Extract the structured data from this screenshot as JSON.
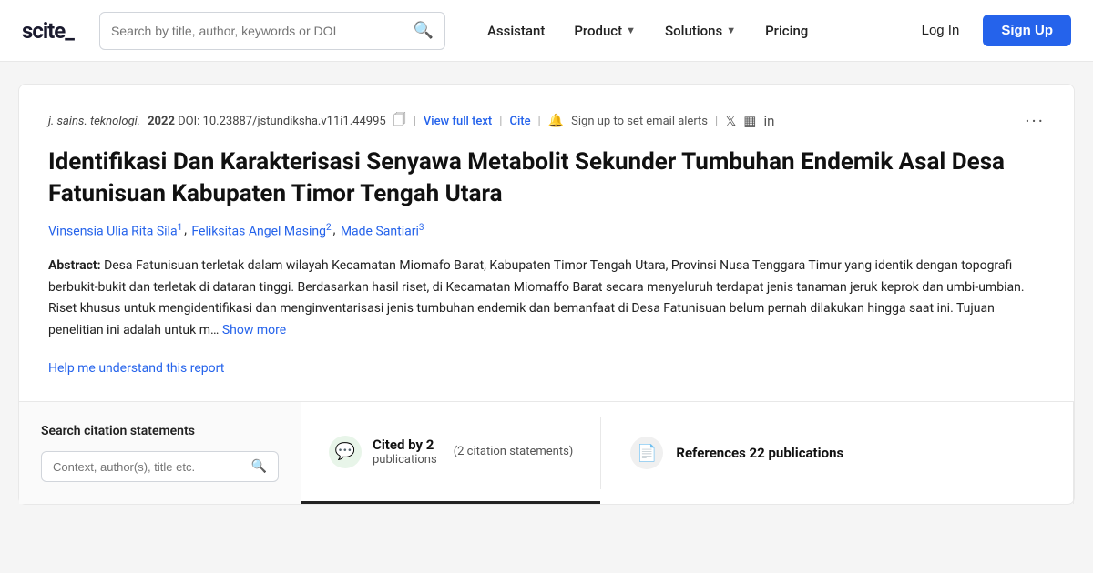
{
  "nav": {
    "logo": "scite_",
    "search_placeholder": "Search by title, author, keywords or DOI",
    "links": [
      {
        "label": "Assistant",
        "has_chevron": false
      },
      {
        "label": "Product",
        "has_chevron": true
      },
      {
        "label": "Solutions",
        "has_chevron": true
      },
      {
        "label": "Pricing",
        "has_chevron": false
      }
    ],
    "login_label": "Log In",
    "signup_label": "Sign Up"
  },
  "article": {
    "journal": "j. sains. teknologi.",
    "year": "2022",
    "doi_prefix": "DOI:",
    "doi": "10.23887/jstundiksha.v11i1.44995",
    "view_full_text": "View full text",
    "cite": "Cite",
    "sign_up_alerts": "Sign up to set email alerts",
    "title": "Identifikasi Dan Karakterisasi Senyawa Metabolit Sekunder Tumbuhan Endemik Asal Desa Fatunisuan Kabupaten Timor Tengah Utara",
    "authors": [
      {
        "name": "Vinsensia Ulia Rita Sila",
        "sup": "1"
      },
      {
        "name": "Feliksitas Angel Masing",
        "sup": "2"
      },
      {
        "name": "Made Santiari",
        "sup": "3"
      }
    ],
    "abstract_label": "Abstract:",
    "abstract_text": "Desa Fatunisuan terletak dalam wilayah Kecamatan Miomafo Barat, Kabupaten Timor Tengah Utara, Provinsi Nusa Tenggara Timur yang identik dengan topografi berbukit-bukit dan terletak di dataran tinggi. Berdasarkan hasil riset, di Kecamatan Miomaffo Barat secara menyeluruh terdapat jenis tanaman  jeruk keprok dan umbi-umbian. Riset khusus untuk mengidentifikasi dan menginventarisasi jenis tumbuhan endemik dan bemanfaat di Desa Fatunisuan belum pernah dilakukan hingga saat ini. Tujuan penelitian ini adalah untuk m…",
    "show_more": "Show more",
    "help_link": "Help me understand this report"
  },
  "citations": {
    "search_title": "Search citation statements",
    "search_placeholder": "Context, author(s), title etc.",
    "cited_by_label": "Cited by 2 publications",
    "cited_by_count": "2",
    "citation_statements_count": "2 citation statements",
    "tab_active_main": "Cited by 2",
    "tab_active_sub": "publications",
    "tab_statements_label": "(2 citation statements)",
    "references_label": "References 22 publications"
  }
}
